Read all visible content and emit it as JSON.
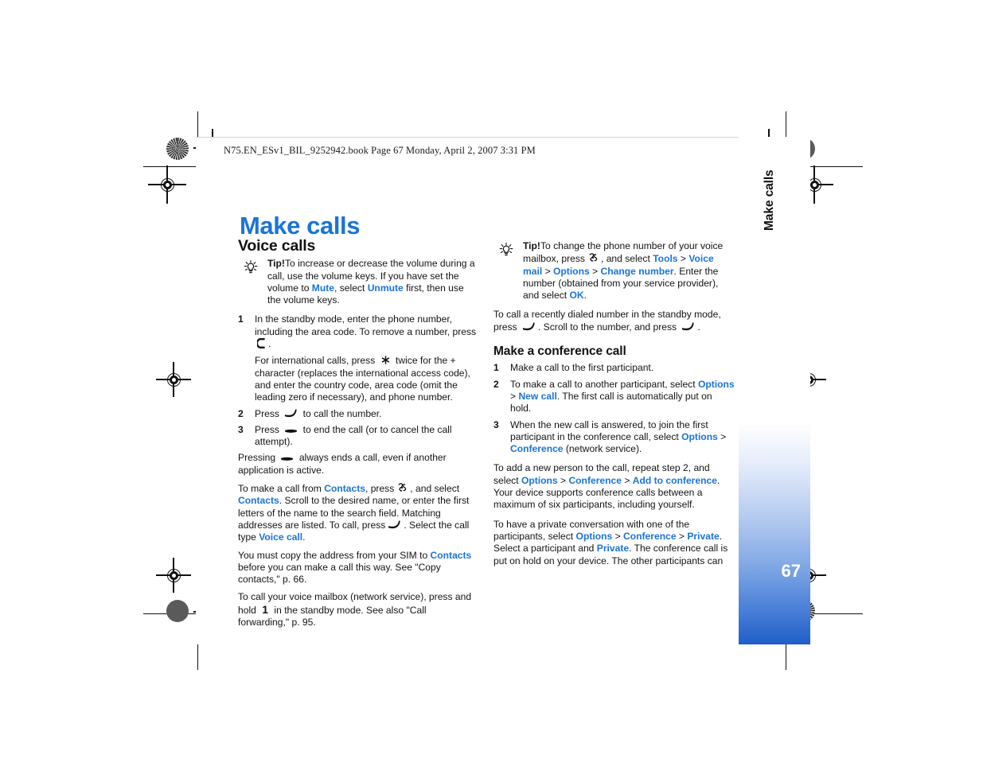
{
  "print_header": {
    "text": "N75.EN_ESv1_BIL_9252942.book  Page 67  Monday, April 2, 2007  3:31 PM"
  },
  "chapter": {
    "title": "Make calls",
    "title_color": "#1a74d8",
    "tab_label": "Make calls",
    "page_number": "67"
  },
  "left_column": {
    "section_title": "Voice calls",
    "tip": {
      "icon": "lightbulb-icon",
      "label": "Tip!",
      "text_1": "To increase or decrease the volume during a call, use the volume keys. If you have set the volume to ",
      "link_1": "Mute",
      "text_2": ", select ",
      "link_2": "Unmute",
      "text_3": " first, then use the volume keys."
    },
    "steps": [
      {
        "num": "1",
        "text_1": "In the standby mode, enter the phone number, including the area code. To remove a number, press",
        "key_1": "clear-key-icon",
        "text_2": ".",
        "continuation_1": "For international calls, press",
        "key_2": "asterisk-key-icon",
        "continuation_2": "twice for the + character (replaces the international access code), and enter the country code, area code (omit the leading zero if necessary), and phone number."
      },
      {
        "num": "2",
        "text_1": "Press",
        "key_1": "call-key-icon",
        "text_2": "to call the number."
      },
      {
        "num": "3",
        "text_1": "Press",
        "key_1": "end-key-icon",
        "text_2": "to end the call (or to cancel the call attempt)."
      }
    ],
    "para_pressing_1": "Pressing",
    "para_pressing_key": "end-key-icon",
    "para_pressing_2": "always ends a call, even if another application is active.",
    "para_contacts_1": "To make a call from ",
    "para_contacts_link_1": "Contacts",
    "para_contacts_2": ", press",
    "para_contacts_key_1": "menu-key-icon",
    "para_contacts_3": ", and select ",
    "para_contacts_link_2": "Contacts",
    "para_contacts_4": ". Scroll to the desired name, or enter the first letters of the name to the search field. Matching addresses are listed. To call, press",
    "para_contacts_key_2": "call-key-icon",
    "para_contacts_5": ". Select the call type ",
    "para_contacts_link_3": "Voice call",
    "para_contacts_6": ".",
    "para_sim_1": "You must copy the address from your SIM to ",
    "para_sim_link": "Contacts",
    "para_sim_2": " before you can make a call this way. See \"Copy contacts,\" p. 66.",
    "para_mailbox_1": "To call your voice mailbox (network service), press and hold",
    "para_mailbox_key": "1",
    "para_mailbox_2": "in the standby mode. See also \"Call forwarding,\" p. 95."
  },
  "right_column": {
    "tip": {
      "icon": "lightbulb-icon",
      "label": "Tip!",
      "text_1": "To change the phone number of your voice mailbox, press",
      "key_1": "menu-key-icon",
      "text_2": ", and select ",
      "link_1": "Tools",
      "sep_1": " > ",
      "link_2": "Voice mail",
      "sep_2": " > ",
      "link_3": "Options",
      "sep_3": " > ",
      "link_4": "Change number",
      "text_3": ". Enter the number (obtained from your service provider), and select ",
      "link_5": "OK",
      "text_4": "."
    },
    "para_redial_1": "To call a recently dialed number in the standby mode, press",
    "para_redial_key_1": "call-key-icon",
    "para_redial_2": ". Scroll to the number, and press",
    "para_redial_key_2": "call-key-icon",
    "para_redial_3": ".",
    "section_title": "Make a conference call",
    "steps": [
      {
        "num": "1",
        "text_1": "Make a call to the first participant."
      },
      {
        "num": "2",
        "text_1": "To make a call to another participant, select ",
        "link_1": "Options",
        "sep_1": " > ",
        "link_2": "New call",
        "text_2": ". The first call is automatically put on hold."
      },
      {
        "num": "3",
        "text_1": "When the new call is answered, to join the first participant in the conference call, select ",
        "link_1": "Options",
        "sep_1": " > ",
        "link_2": "Conference",
        "text_2": " (network service)."
      }
    ],
    "para_add_1": "To add a new person to the call, repeat step 2, and select ",
    "para_add_link_1": "Options",
    "para_add_sep_1": " > ",
    "para_add_link_2": "Conference",
    "para_add_sep_2": " > ",
    "para_add_link_3": "Add to conference",
    "para_add_2": ". Your device supports conference calls between a maximum of six participants, including yourself.",
    "para_private_1": "To have a private conversation with one of the participants, select ",
    "para_private_link_1": "Options",
    "para_private_sep_1": " > ",
    "para_private_link_2": "Conference",
    "para_private_sep_2": " > ",
    "para_private_link_3": "Private",
    "para_private_2": ". Select a participant and ",
    "para_private_link_4": "Private",
    "para_private_3": ". The conference call is put on hold on your device. The other participants can"
  }
}
